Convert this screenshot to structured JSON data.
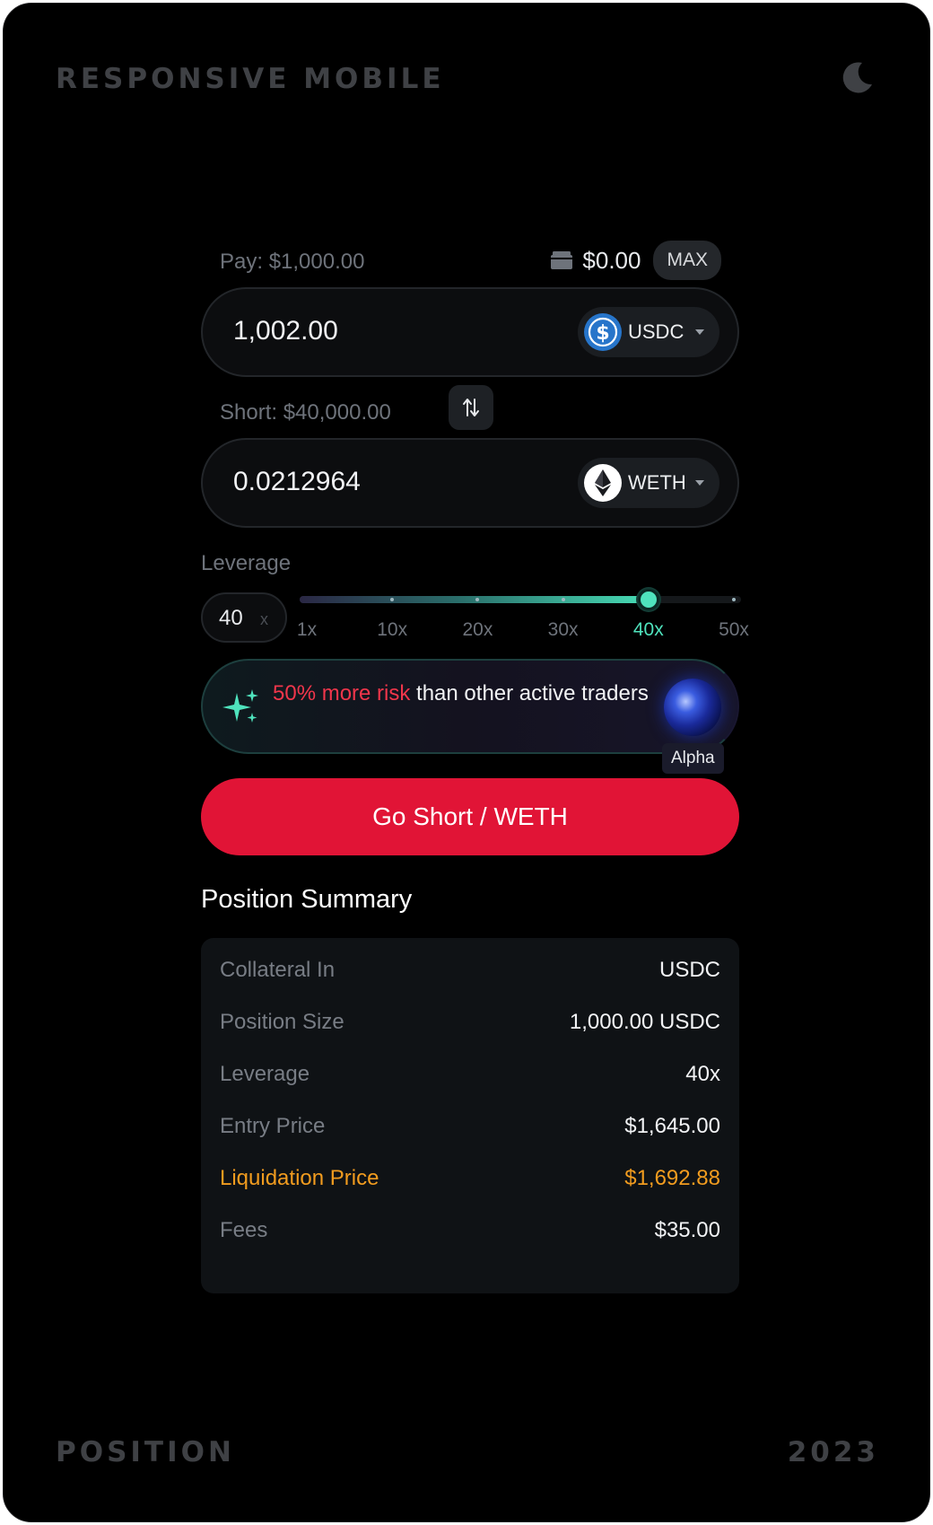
{
  "frame": {
    "title": "RESPONSIVE MOBILE",
    "footer_left": "POSITION",
    "footer_right": "2023"
  },
  "pay": {
    "label": "Pay: $1,000.00",
    "balance": "$0.00",
    "max_label": "MAX",
    "amount": "1,002.00",
    "token": "USDC"
  },
  "short": {
    "label": "Short: $40,000.00",
    "amount": "0.0212964",
    "token": "WETH"
  },
  "leverage": {
    "label": "Leverage",
    "value": "40",
    "clear": "x",
    "ticks": [
      "1x",
      "10x",
      "20x",
      "30x",
      "40x",
      "50x"
    ],
    "selected_index": 4,
    "max": 50,
    "selected_value": 40
  },
  "risk": {
    "highlight": "50% more risk",
    "text": " than other active traders",
    "badge": "Alpha"
  },
  "cta": {
    "label": "Go Short / WETH"
  },
  "summary": {
    "title": "Position Summary",
    "rows": [
      {
        "key": "Collateral In",
        "value": "USDC"
      },
      {
        "key": "Position Size",
        "value": "1,000.00 USDC"
      },
      {
        "key": "Leverage",
        "value": "40x"
      },
      {
        "key": "Entry Price",
        "value": "$1,645.00"
      },
      {
        "key": "Liquidation Price",
        "value": "$1,692.88"
      },
      {
        "key": "Fees",
        "value": "$35.00"
      }
    ]
  },
  "icons": {
    "theme": "moon-icon",
    "wallet": "wallet-icon",
    "swap": "swap-arrows-icon",
    "usdc": "usdc-token-icon",
    "weth": "ethereum-token-icon",
    "chevron": "chevron-down-icon",
    "sparkle": "sparkle-icon"
  },
  "colors": {
    "background": "#000000",
    "accent_green": "#4fe3bd",
    "cta_red": "#e11436",
    "risk_red": "#f1364b",
    "warning_orange": "#f29c1f"
  }
}
